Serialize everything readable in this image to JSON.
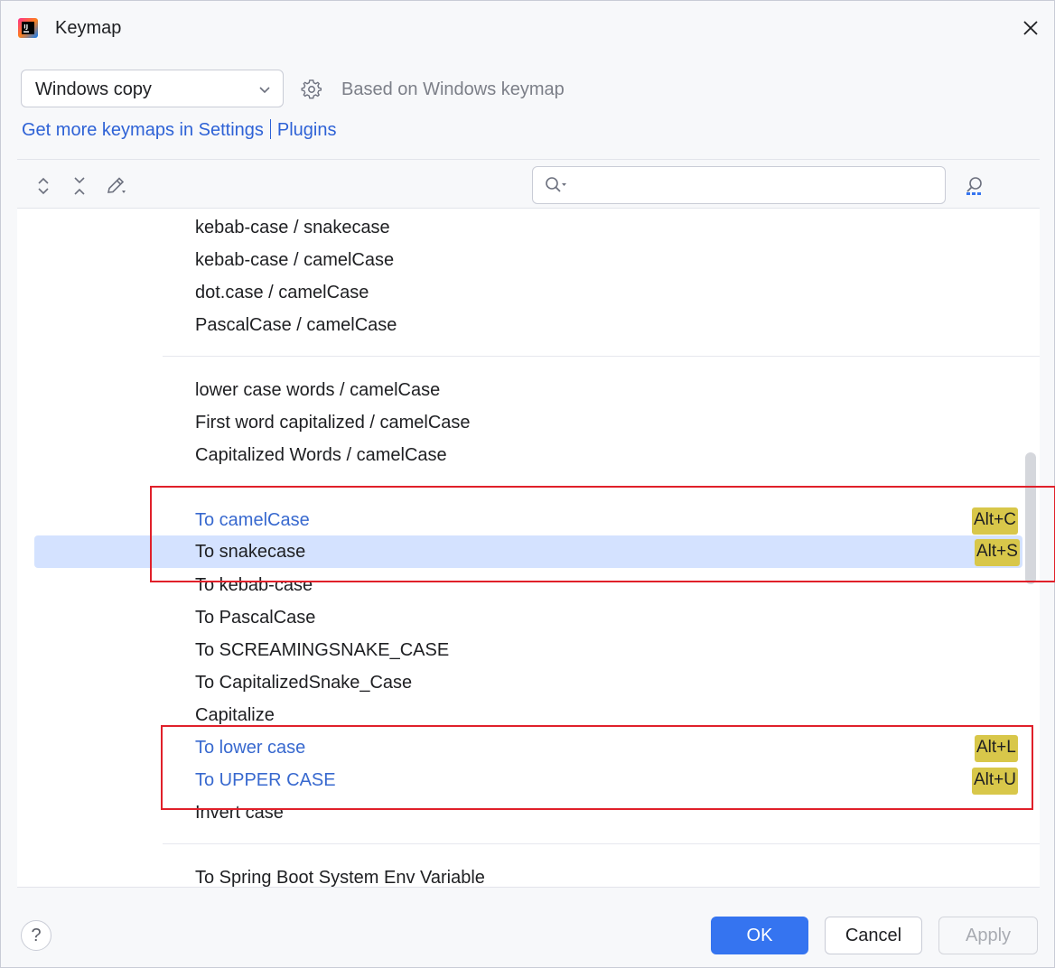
{
  "window": {
    "title": "Keymap",
    "logo_icon": "intellij-idea-logo-icon",
    "close_icon": "close-icon"
  },
  "keymap": {
    "selected": "Windows copy",
    "based_on": "Based on Windows keymap",
    "settings_icon": "gear-icon"
  },
  "links": {
    "get_more": "Get more keymaps in Settings",
    "plugins": "Plugins"
  },
  "toolbar": {
    "expand_all_icon": "expand-all-icon",
    "collapse_all_icon": "collapse-all-icon",
    "edit_icon": "edit-shortcut-icon",
    "search_icon": "search-icon",
    "search_value": "",
    "find_by_shortcut_icon": "find-by-shortcut-icon"
  },
  "tree": {
    "rows": [
      {
        "label": "kebab-case / snakecase"
      },
      {
        "label": "kebab-case / camelCase"
      },
      {
        "label": "dot.case / camelCase"
      },
      {
        "label": "PascalCase / camelCase"
      },
      {
        "label": "lower case words / camelCase"
      },
      {
        "label": "First word capitalized / camelCase"
      },
      {
        "label": "Capitalized Words / camelCase"
      },
      {
        "label": "To camelCase",
        "shortcut": "Alt+C"
      },
      {
        "label": "To snakecase",
        "shortcut": "Alt+S"
      },
      {
        "label": "To kebab-case"
      },
      {
        "label": "To PascalCase"
      },
      {
        "label": "To SCREAMINGSNAKE_CASE"
      },
      {
        "label": "To CapitalizedSnake_Case"
      },
      {
        "label": "Capitalize"
      },
      {
        "label": "To lower case",
        "shortcut": "Alt+L"
      },
      {
        "label": "To UPPER CASE",
        "shortcut": "Alt+U"
      },
      {
        "label": "Invert case"
      },
      {
        "label": "To Spring Boot System Env Variable"
      }
    ]
  },
  "footer": {
    "help": "?",
    "ok": "OK",
    "cancel": "Cancel",
    "apply": "Apply"
  },
  "colors": {
    "accent": "#3574f0",
    "link": "#2e62d6",
    "shortcut_badge": "#d8c74a",
    "selection": "#d4e2ff",
    "annotation_frame": "#e0202a"
  }
}
